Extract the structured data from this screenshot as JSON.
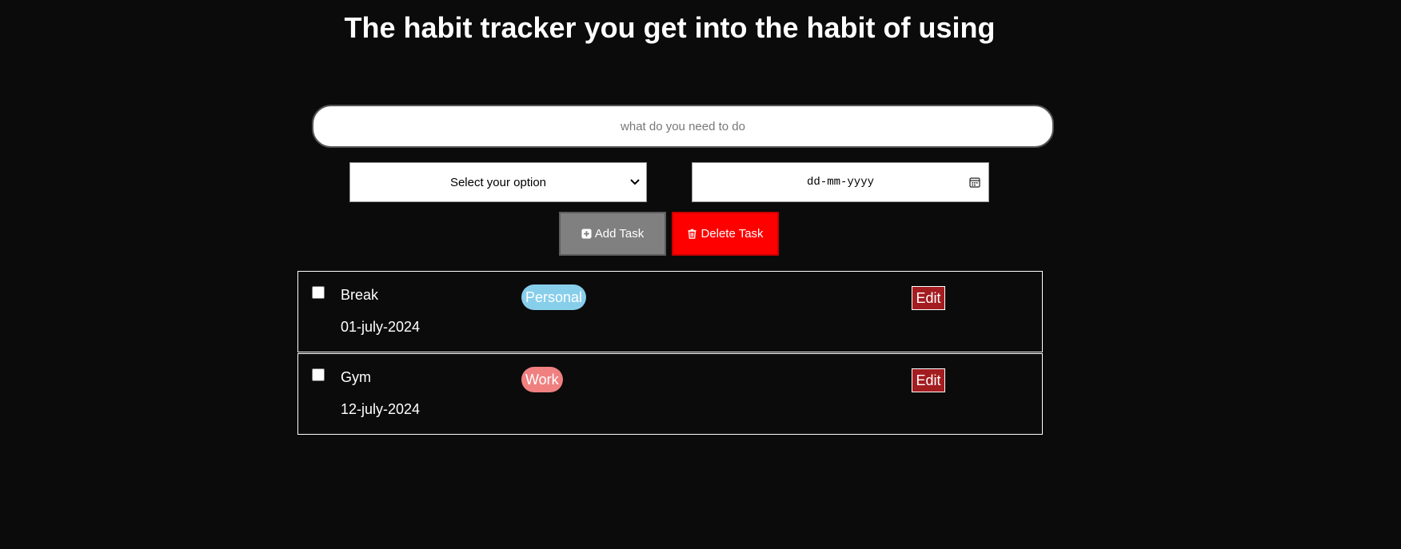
{
  "header": {
    "title": "The habit tracker you get into the habit of using"
  },
  "form": {
    "task_placeholder": "what do you need to do",
    "category_select": {
      "selected": "Select your option"
    },
    "date_placeholder": "dd-mm-yyyy",
    "add_label": "Add Task",
    "delete_label": "Delete Task"
  },
  "tasks": [
    {
      "name": "Break",
      "date": "01-july-2024",
      "tag": "Personal",
      "tag_color": "#87ceeb",
      "edit_label": "Edit",
      "checked": false
    },
    {
      "name": "Gym",
      "date": "12-july-2024",
      "tag": "Work",
      "tag_color": "#f08080",
      "edit_label": "Edit",
      "checked": false
    }
  ],
  "colors": {
    "background": "#0b0b0b",
    "add_button": "#808080",
    "delete_button": "#ff0000",
    "edit_button": "#a31c20"
  },
  "icons": {
    "add_icon": "plus-square-icon",
    "delete_icon": "trash-icon",
    "select_icon": "chevron-down-icon",
    "date_icon": "calendar-icon"
  }
}
